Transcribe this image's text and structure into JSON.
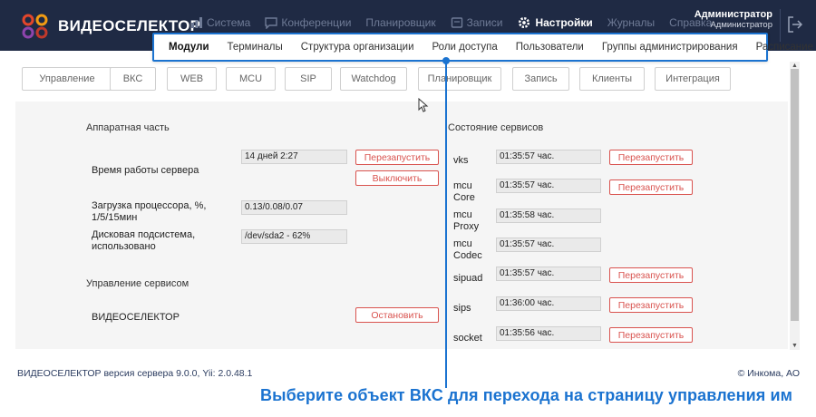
{
  "brand": {
    "name": "ВИДЕОСЕЛЕКТОР",
    "accent_colors": [
      "#e4462b",
      "#f39c12",
      "#8e44ad",
      "#1b73d0"
    ]
  },
  "nav": {
    "items": [
      {
        "label": "Система",
        "icon": "chart-icon",
        "active": false
      },
      {
        "label": "Конференции",
        "icon": "chat-icon",
        "active": false
      },
      {
        "label": "Планировщик",
        "icon": "",
        "active": false
      },
      {
        "label": "Записи",
        "icon": "record-icon",
        "active": false
      },
      {
        "label": "Настройки",
        "icon": "gear-icon",
        "active": true
      },
      {
        "label": "Журналы",
        "icon": "",
        "active": false
      },
      {
        "label": "Справка",
        "icon": "",
        "active": false
      }
    ]
  },
  "user": {
    "name": "Администратор",
    "role": "Администратор"
  },
  "subnav": {
    "items": [
      {
        "label": "Модули",
        "active": true
      },
      {
        "label": "Терминалы",
        "active": false
      },
      {
        "label": "Структура организации",
        "active": false
      },
      {
        "label": "Роли доступа",
        "active": false
      },
      {
        "label": "Пользователи",
        "active": false
      },
      {
        "label": "Группы администрирования",
        "active": false
      },
      {
        "label": "Расписание",
        "active": false
      }
    ]
  },
  "tabs": [
    "Управление",
    "ВКС",
    "WEB",
    "MCU",
    "SIP",
    "Watchdog",
    "Планировщик",
    "Запись",
    "Клиенты",
    "Интеграция"
  ],
  "hardware": {
    "title": "Аппаратная часть",
    "uptime_label": "Время работы сервера",
    "uptime_value": "14 дней 2:27",
    "restart_label": "Перезапустить",
    "shutdown_label": "Выключить",
    "cpu_label": "Загрузка процессора, %, 1/5/15мин",
    "cpu_value": "0.13/0.08/0.07",
    "disk_label": "Дисковая подсистема, использовано",
    "disk_value": "/dev/sda2 - 62%"
  },
  "service_control": {
    "title": "Управление сервисом",
    "name": "ВИДЕОСЕЛЕКТОР",
    "stop_label": "Остановить"
  },
  "services": {
    "title": "Состояние сервисов",
    "restart_label": "Перезапустить",
    "rows": [
      {
        "name": "vks",
        "uptime": "01:35:57 час.",
        "has_restart": true
      },
      {
        "name": "mcu Core",
        "uptime": "01:35:57 час.",
        "has_restart": true
      },
      {
        "name": "mcu Proxy",
        "uptime": "01:35:58 час.",
        "has_restart": false
      },
      {
        "name": "mcu Codec",
        "uptime": "01:35:57 час.",
        "has_restart": false
      },
      {
        "name": "sipuad",
        "uptime": "01:35:57 час.",
        "has_restart": true
      },
      {
        "name": "sips",
        "uptime": "01:36:00 час.",
        "has_restart": true
      },
      {
        "name": "socket",
        "uptime": "01:35:56 час.",
        "has_restart": true
      }
    ]
  },
  "footer": {
    "version": "ВИДЕОСЕЛЕКТОР версия сервера 9.0.0, Yii: 2.0.48.1",
    "copyright": "© Инкома, АО"
  },
  "caption": "Выберите объект ВКС для перехода на страницу управления им"
}
